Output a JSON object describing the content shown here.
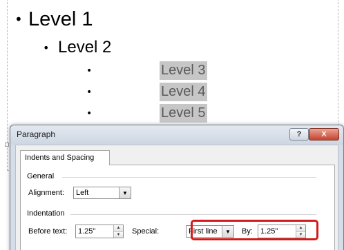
{
  "slide": {
    "bullets": [
      {
        "level": 1,
        "text": "Level 1"
      },
      {
        "level": 2,
        "text": "Level 2"
      },
      {
        "level": 3,
        "text": "Level 3"
      },
      {
        "level": 4,
        "text": "Level 4"
      },
      {
        "level": 5,
        "text": "Level 5"
      }
    ],
    "bullet_glyph": "•"
  },
  "dialog": {
    "title": "Paragraph",
    "help_label": "?",
    "close_label": "X",
    "tabs": [
      {
        "label": "Indents and Spacing",
        "selected": true
      }
    ],
    "general": {
      "heading": "General",
      "alignment_label": "Alignment:",
      "alignment_value": "Left"
    },
    "indentation": {
      "heading": "Indentation",
      "before_text_label": "Before text:",
      "before_text_value": "1.25\"",
      "special_label": "Special:",
      "special_value": "First line",
      "by_label": "By:",
      "by_value": "1.25\""
    },
    "highlight_color": "#d11a1a"
  }
}
